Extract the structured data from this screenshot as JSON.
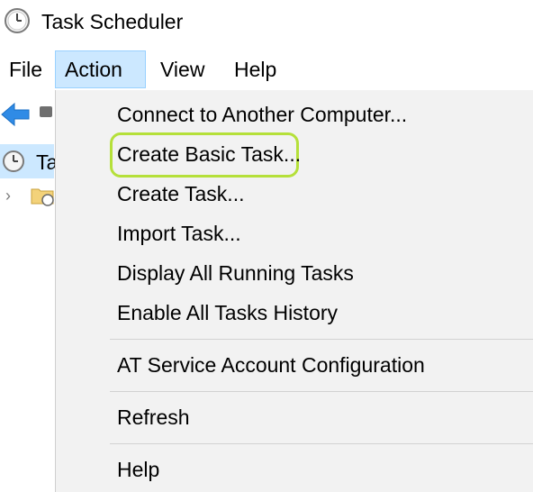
{
  "window": {
    "title": "Task Scheduler"
  },
  "menubar": {
    "items": [
      {
        "label": "File"
      },
      {
        "label": "Action"
      },
      {
        "label": "View"
      },
      {
        "label": "Help"
      }
    ]
  },
  "tree": {
    "root_label": "Ta"
  },
  "action_menu": {
    "items": [
      {
        "label": "Connect to Another Computer..."
      },
      {
        "label": "Create Basic Task..."
      },
      {
        "label": "Create Task..."
      },
      {
        "label": "Import Task..."
      },
      {
        "label": "Display All Running Tasks"
      },
      {
        "label": "Enable All Tasks History"
      },
      {
        "label": "AT Service Account Configuration"
      },
      {
        "label": "Refresh"
      },
      {
        "label": "Help"
      }
    ]
  },
  "colors": {
    "highlight_ring": "#b5e03a",
    "menu_active_bg": "#cce8ff",
    "dropdown_bg": "#f2f2f2"
  },
  "icons": {
    "app": "clock-icon",
    "back": "back-arrow-icon",
    "tree_root": "clock-icon",
    "tree_folder": "folder-clock-icon",
    "tree_expand": "chevron-right-icon"
  }
}
